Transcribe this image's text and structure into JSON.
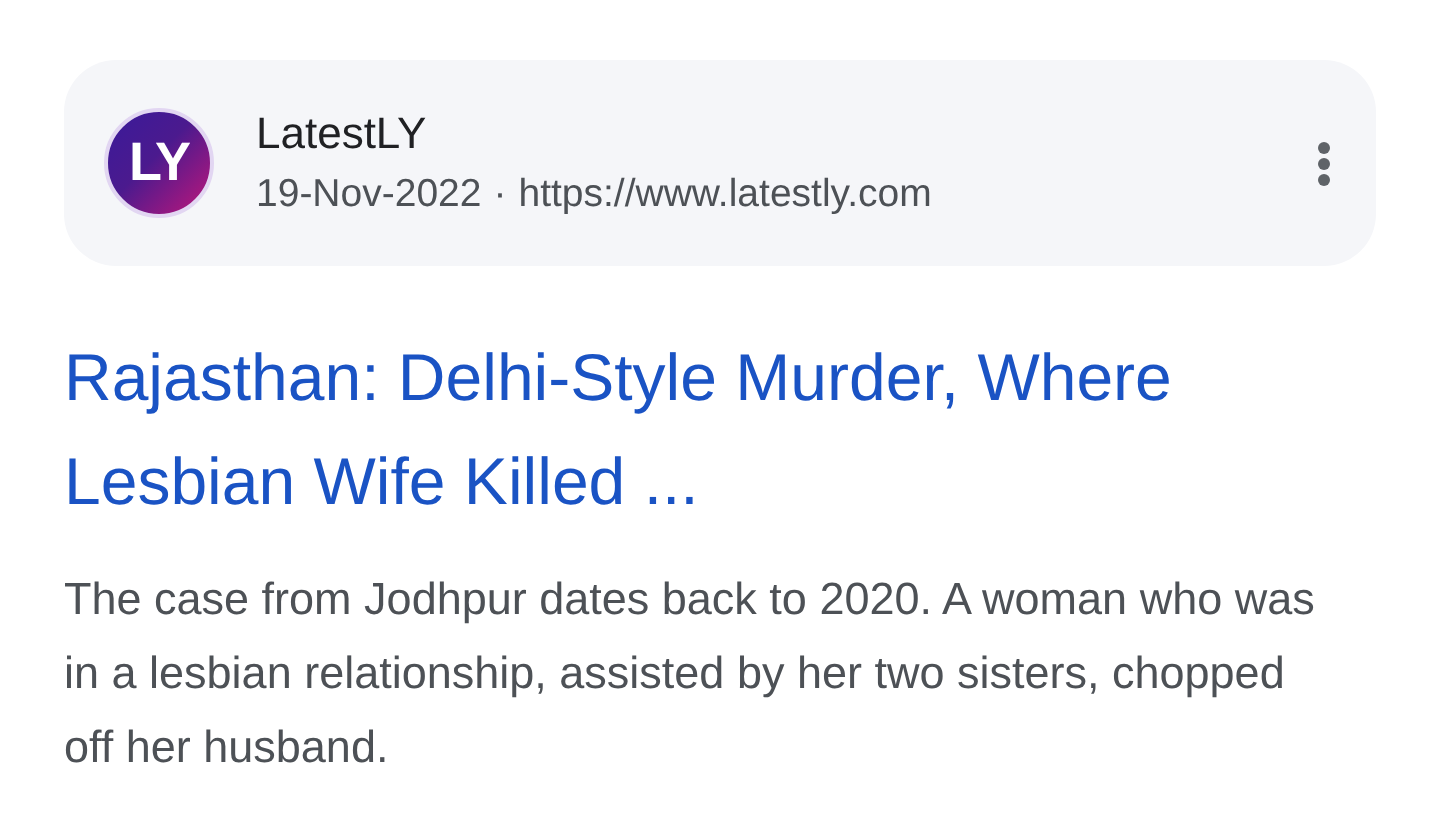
{
  "source": {
    "logo_text": "LY",
    "name": "LatestLY",
    "date": "19-Nov-2022",
    "separator": "·",
    "url": "https://www.latestly.com"
  },
  "result": {
    "title": "Rajasthan: Delhi-Style Murder, Where Lesbian Wife Killed ...",
    "snippet": "The case from Jodhpur dates back to 2020. A woman who was in a lesbian relationship, assisted by her two sisters, chopped off her husband."
  }
}
